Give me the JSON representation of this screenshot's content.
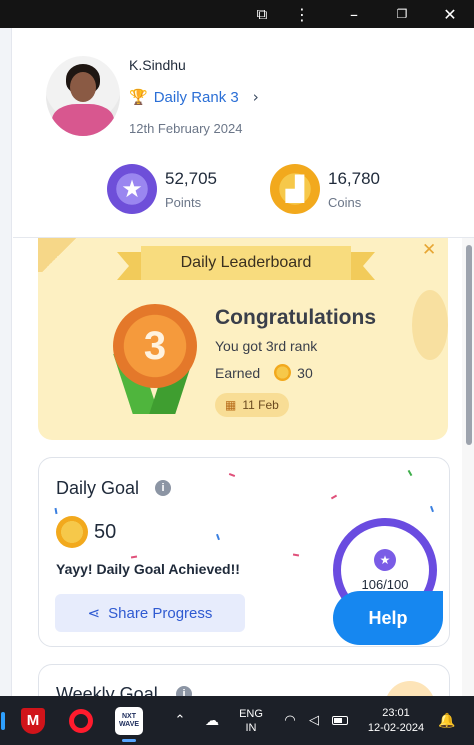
{
  "window": {
    "icons": [
      "extension-icon",
      "more-icon",
      "minimize-icon",
      "maximize-icon",
      "close-icon"
    ],
    "ext_glyph": "⧉",
    "more_glyph": "⋮",
    "min_glyph": "–",
    "max_glyph": "❐",
    "close_glyph": "✕"
  },
  "profile": {
    "name": "K.Sindhu",
    "rank_icon": "trophy-icon",
    "rank_glyph": "🏆",
    "rank_label": "Daily Rank 3",
    "rank_chevron": "›",
    "date": "12th February 2024",
    "points_value": "52,705",
    "points_label": "Points",
    "points_glyph": "★",
    "coins_value": "16,780",
    "coins_label": "Coins",
    "coins_glyph": "▟"
  },
  "leaderboard": {
    "title": "Daily Leaderboard",
    "close_glyph": "✕",
    "medal_number": "3",
    "heading": "Congratulations",
    "subtitle": "You got 3rd rank",
    "earned_label": "Earned",
    "earned_value": "30",
    "date_glyph": "▦",
    "date_chip": "11 Feb"
  },
  "daily_goal": {
    "title": "Daily Goal",
    "info_glyph": "i",
    "coins_value": "50",
    "achieved_text": "Yayy! Daily Goal Achieved!!",
    "share_glyph": "⋖",
    "share_label": "Share Progress",
    "progress_text": "106/100",
    "progress_fraction": 1.0,
    "star_glyph": "★"
  },
  "help": {
    "label": "Help"
  },
  "weekly_goal": {
    "title": "Weekly Goal",
    "info_glyph": "i"
  },
  "taskbar": {
    "mcafee_glyph": "M",
    "app_label": "NXT WAVE",
    "chevron_glyph": "⌃",
    "cloud_glyph": "☁",
    "lang_line1": "ENG",
    "lang_line2": "IN",
    "wifi_glyph": "◠",
    "volume_glyph": "◁",
    "time": "23:01",
    "date": "12-02-2024",
    "bell_glyph": "🔔"
  },
  "colors": {
    "accent_blue": "#1687f0",
    "purple": "#6a4ce0",
    "gold": "#f2a91d",
    "leaderboard_bg": "#fdf0c2"
  }
}
